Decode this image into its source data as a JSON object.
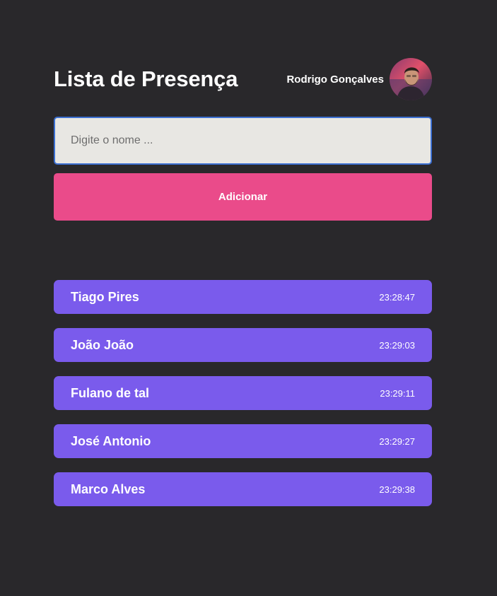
{
  "header": {
    "title": "Lista de Presença",
    "user_name": "Rodrigo Gonçalves",
    "avatar_icon": "user-avatar-photo"
  },
  "form": {
    "input_placeholder": "Digite o nome ...",
    "input_value": "",
    "add_label": "Adicionar"
  },
  "colors": {
    "background": "#29282b",
    "accent_button": "#ea4b8a",
    "card": "#7a5bec",
    "input_bg": "#e8e7e3",
    "input_focus_border": "#3b6fd1"
  },
  "attendees": [
    {
      "name": "Tiago Pires",
      "time": "23:28:47"
    },
    {
      "name": "João João",
      "time": "23:29:03"
    },
    {
      "name": "Fulano de tal",
      "time": "23:29:11"
    },
    {
      "name": "José Antonio",
      "time": "23:29:27"
    },
    {
      "name": "Marco Alves",
      "time": "23:29:38"
    }
  ]
}
